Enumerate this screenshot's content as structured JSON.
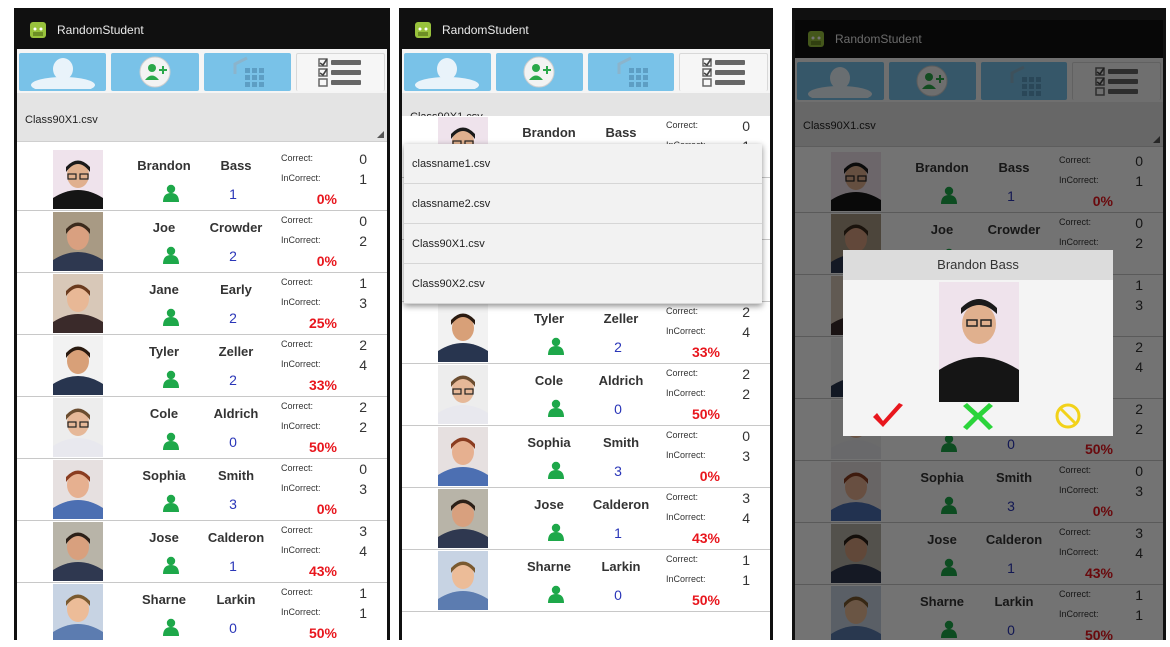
{
  "app": {
    "title": "RandomStudent"
  },
  "tabs": [
    {
      "icon": "student-silhouette-icon"
    },
    {
      "icon": "add-student-icon"
    },
    {
      "icon": "import-grid-icon"
    },
    {
      "icon": "checklist-icon",
      "active": true
    }
  ],
  "spinner": {
    "selected": "Class90X1.csv"
  },
  "labels": {
    "correct": "Correct:",
    "incorrect": "InCorrect:"
  },
  "colors": {
    "tab_blue": "#79c2e8",
    "percent_red": "#e8161d",
    "person_green": "#1ea84a",
    "number_blue": "#2a36b8"
  },
  "students": [
    {
      "first": "Brandon",
      "last": "Bass",
      "count": "1",
      "correct": "0",
      "incorrect": "1",
      "percent": "0%"
    },
    {
      "first": "Joe",
      "last": "Crowder",
      "count": "2",
      "correct": "0",
      "incorrect": "2",
      "percent": "0%"
    },
    {
      "first": "Jane",
      "last": "Early",
      "count": "2",
      "correct": "1",
      "incorrect": "3",
      "percent": "25%"
    },
    {
      "first": "Tyler",
      "last": "Zeller",
      "count": "2",
      "correct": "2",
      "incorrect": "4",
      "percent": "33%"
    },
    {
      "first": "Cole",
      "last": "Aldrich",
      "count": "0",
      "correct": "2",
      "incorrect": "2",
      "percent": "50%"
    },
    {
      "first": "Sophia",
      "last": "Smith",
      "count": "3",
      "correct": "0",
      "incorrect": "3",
      "percent": "0%"
    },
    {
      "first": "Jose",
      "last": "Calderon",
      "count": "1",
      "correct": "3",
      "incorrect": "4",
      "percent": "43%"
    },
    {
      "first": "Sharne",
      "last": "Larkin",
      "count": "0",
      "correct": "1",
      "incorrect": "1",
      "percent": "50%"
    }
  ],
  "dropdown": {
    "options": [
      "classname1.csv",
      "classname2.csv",
      "Class90X1.csv",
      "Class90X2.csv"
    ]
  },
  "dialog": {
    "title": "Brandon Bass",
    "buttons": [
      {
        "icon": "checkmark-icon",
        "color": "#e8161d"
      },
      {
        "icon": "x-icon",
        "color": "#2bd43a"
      },
      {
        "icon": "no-entry-icon",
        "color": "#f2d21a"
      }
    ]
  }
}
